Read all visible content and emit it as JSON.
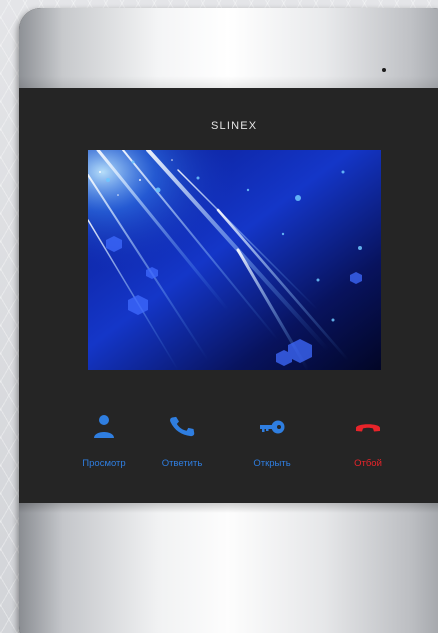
{
  "brand": "SLINEX",
  "colors": {
    "accent_blue": "#2f7ee0",
    "hangup_red": "#e8242a",
    "panel": "#252525"
  },
  "buttons": [
    {
      "id": "view",
      "label": "Просмотр",
      "icon": "person-icon",
      "color": "#2f7ee0"
    },
    {
      "id": "answer",
      "label": "Ответить",
      "icon": "phone-answer-icon",
      "color": "#2f7ee0"
    },
    {
      "id": "open",
      "label": "Открыть",
      "icon": "key-icon",
      "color": "#2f7ee0"
    },
    {
      "id": "hangup",
      "label": "Отбой",
      "icon": "phone-hangup-icon",
      "color": "#e8242a"
    }
  ]
}
